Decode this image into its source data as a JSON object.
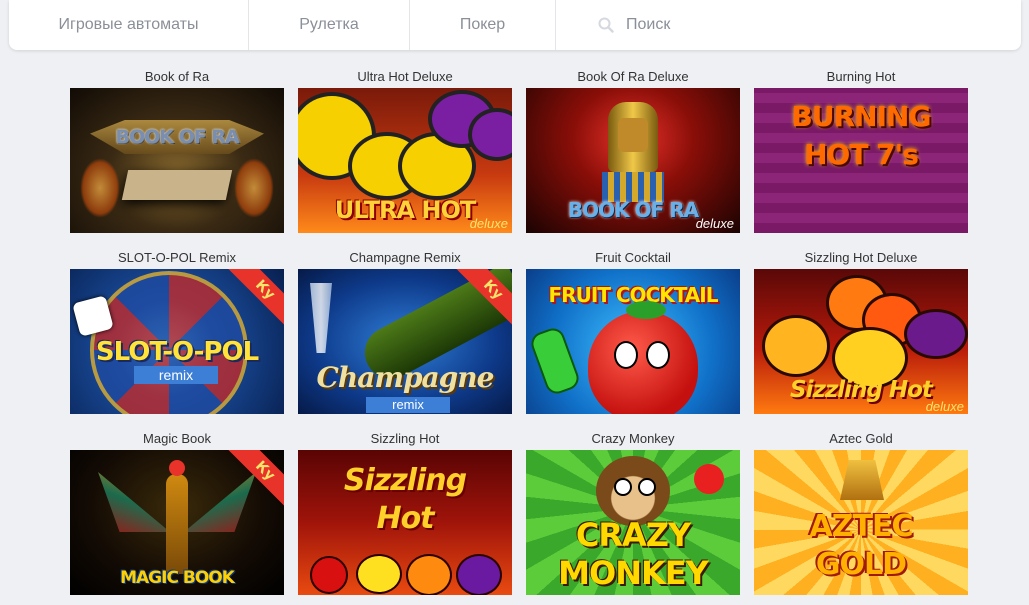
{
  "nav": {
    "tabs": [
      "Игровые автоматы",
      "Рулетка",
      "Покер"
    ],
    "search_placeholder": "Поиск"
  },
  "games": [
    {
      "title": "Book of Ra",
      "art": "BOOK OF RA"
    },
    {
      "title": "Ultra Hot Deluxe",
      "art": "ULTRA HOT",
      "sub": "deluxe"
    },
    {
      "title": "Book Of Ra Deluxe",
      "art": "BOOK OF RA",
      "sub": "deluxe"
    },
    {
      "title": "Burning Hot",
      "art": "BURNING HOT 7's"
    },
    {
      "title": "SLOT-O-POL Remix",
      "art": "SLOT-O-POL",
      "sub": "remix",
      "badge": "Ку"
    },
    {
      "title": "Champagne Remix",
      "art": "Champagne",
      "sub": "remix",
      "badge": "Ку"
    },
    {
      "title": "Fruit Cocktail",
      "art": "FRUIT COCKTAIL"
    },
    {
      "title": "Sizzling Hot Deluxe",
      "art": "Sizzling Hot",
      "sub": "deluxe"
    },
    {
      "title": "Magic Book",
      "art": "MAGIC BOOK",
      "badge": "Ку"
    },
    {
      "title": "Sizzling Hot",
      "art": "Sizzling Hot"
    },
    {
      "title": "Crazy Monkey",
      "art": "CRAZY MONKEY"
    },
    {
      "title": "Aztec Gold",
      "art": "AZTEC GOLD"
    }
  ]
}
